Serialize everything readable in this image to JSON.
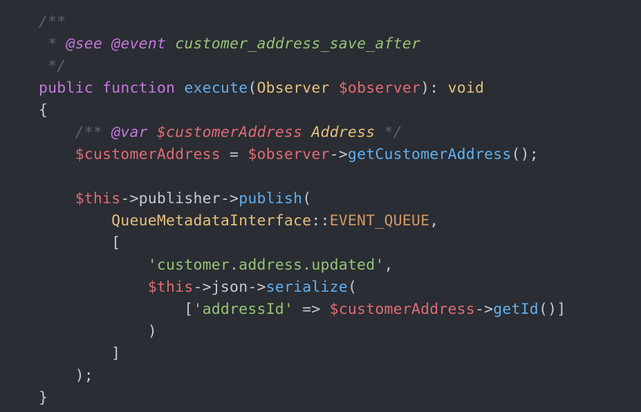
{
  "code": {
    "l1": {
      "a": "/**"
    },
    "l2": {
      "a": " * ",
      "b": "@see",
      "c": " ",
      "d": "@event",
      "e": " ",
      "f": "customer_address_save_after"
    },
    "l3": {
      "a": " */"
    },
    "l4": {
      "a": "public",
      "b": " ",
      "c": "function",
      "d": " ",
      "e": "execute",
      "f": "(",
      "g": "Observer",
      "h": " ",
      "i": "$observer",
      "j": "): ",
      "k": "void"
    },
    "l5": {
      "a": "{"
    },
    "l6": {
      "a": "    ",
      "b": "/** ",
      "c": "@var",
      "d": " ",
      "e": "$customerAddress",
      "f": " ",
      "g": "Address",
      "h": " */"
    },
    "l7": {
      "a": "    ",
      "b": "$customerAddress",
      "c": " = ",
      "d": "$observer",
      "e": "->",
      "f": "getCustomerAddress",
      "g": "();"
    },
    "l8": {
      "a": ""
    },
    "l9": {
      "a": "    ",
      "b": "$this",
      "c": "->",
      "d": "publisher",
      "e": "->",
      "f": "publish",
      "g": "("
    },
    "l10": {
      "a": "        ",
      "b": "QueueMetadataInterface",
      "c": "::",
      "d": "EVENT_QUEUE",
      "e": ","
    },
    "l11": {
      "a": "        ["
    },
    "l12": {
      "a": "            ",
      "b": "'customer.address.updated'",
      "c": ","
    },
    "l13": {
      "a": "            ",
      "b": "$this",
      "c": "->",
      "d": "json",
      "e": "->",
      "f": "serialize",
      "g": "("
    },
    "l14": {
      "a": "                [",
      "b": "'addressId'",
      "c": " => ",
      "d": "$customerAddress",
      "e": "->",
      "f": "getId",
      "g": "()]"
    },
    "l15": {
      "a": "            )"
    },
    "l16": {
      "a": "        ]"
    },
    "l17": {
      "a": "    );"
    },
    "l18": {
      "a": "}"
    }
  }
}
